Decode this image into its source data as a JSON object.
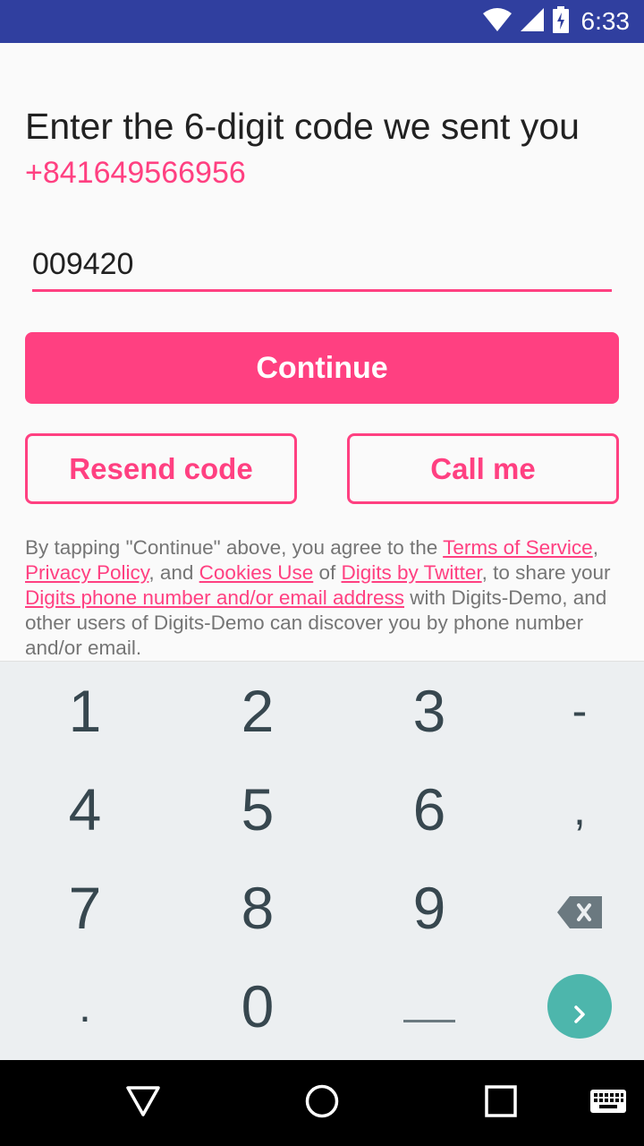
{
  "status_bar": {
    "time": "6:33",
    "icons": [
      "wifi-icon",
      "signal-icon",
      "battery-charging-icon"
    ]
  },
  "verify": {
    "title": "Enter the 6-digit code we sent you",
    "phone": "+841649566956",
    "code_value": "009420",
    "continue_label": "Continue",
    "resend_label": "Resend code",
    "call_label": "Call me"
  },
  "legal": {
    "t1": "By tapping \"Continue\" above, you agree to the ",
    "terms": "Terms of Service",
    "t2": ", ",
    "privacy": "Privacy Policy",
    "t3": ", and ",
    "cookies": "Cookies Use",
    "t4": " of ",
    "digits": "Digits by Twitter",
    "t5": ", to share your ",
    "phone_link": "Digits phone number and/or email address",
    "t6": " with Digits-Demo, and other users of Digits-Demo can discover you by phone number and/or email."
  },
  "keyboard": {
    "keys": [
      "1",
      "2",
      "3",
      "-",
      "4",
      "5",
      "6",
      ",",
      "7",
      "8",
      "9",
      "backspace-icon",
      ".",
      "0",
      "__",
      "enter-arrow-icon"
    ]
  },
  "colors": {
    "accent": "#ff4081",
    "status_bar": "#303f9f",
    "keyboard_bg": "#eceff1",
    "enter_key": "#4db6ac"
  }
}
